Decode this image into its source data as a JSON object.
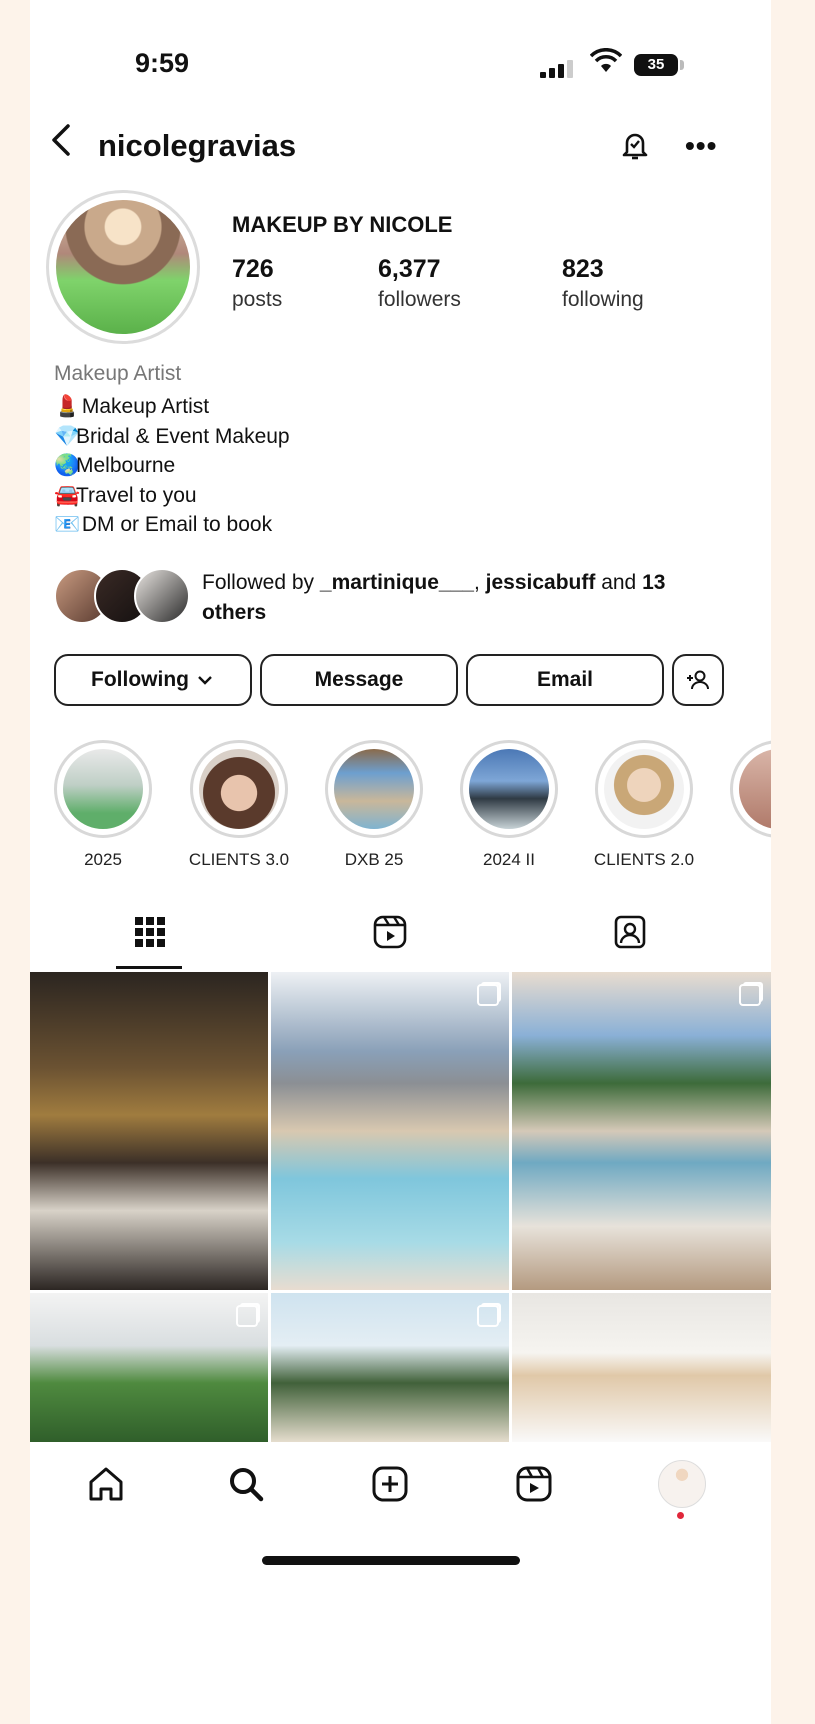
{
  "status_bar": {
    "time": "9:59",
    "battery": "35"
  },
  "header": {
    "username": "nicolegravias"
  },
  "profile": {
    "display_name": "MAKEUP BY NICOLE",
    "stats": [
      {
        "value": "726",
        "label": "posts"
      },
      {
        "value": "6,377",
        "label": "followers"
      },
      {
        "value": "823",
        "label": "following"
      }
    ],
    "category": "Makeup Artist",
    "bio": [
      {
        "icon": "lipstick-icon",
        "glyph": "💄",
        "text": "Makeup Artist"
      },
      {
        "icon": "gem-icon",
        "glyph": "💎",
        "text": "Bridal & Event Makeup"
      },
      {
        "icon": "globe-icon",
        "glyph": "🌏",
        "text": "Melbourne"
      },
      {
        "icon": "car-icon",
        "glyph": "🚘",
        "text": "Travel to you"
      },
      {
        "icon": "mailbox-icon",
        "glyph": "📧",
        "text": "DM or Email to book"
      }
    ]
  },
  "followed_by": {
    "prefix": "Followed by ",
    "user1": "_martinique___",
    "sep": ", ",
    "user2": "jessicabuff",
    "and": " and ",
    "count": "13",
    "suffix": "others"
  },
  "actions": {
    "following": "Following",
    "message": "Message",
    "email": "Email"
  },
  "highlights": [
    {
      "label": "2025",
      "color": "#9fb7a8"
    },
    {
      "label": "CLIENTS 3.0",
      "color": "#7a5a4a"
    },
    {
      "label": "DXB 25",
      "color": "#6b8fb0"
    },
    {
      "label": "2024 II",
      "color": "#5f87b8"
    },
    {
      "label": "CLIENTS 2.0",
      "color": "#c9b8a5"
    }
  ],
  "tabs": [
    "grid-icon",
    "reels-icon",
    "tagged-icon"
  ],
  "bottom_nav": [
    "home-icon",
    "search-icon",
    "create-icon",
    "reels-icon",
    "profile-avatar"
  ],
  "colors": {
    "accent": "#111111",
    "background": "#fdf3ea"
  }
}
